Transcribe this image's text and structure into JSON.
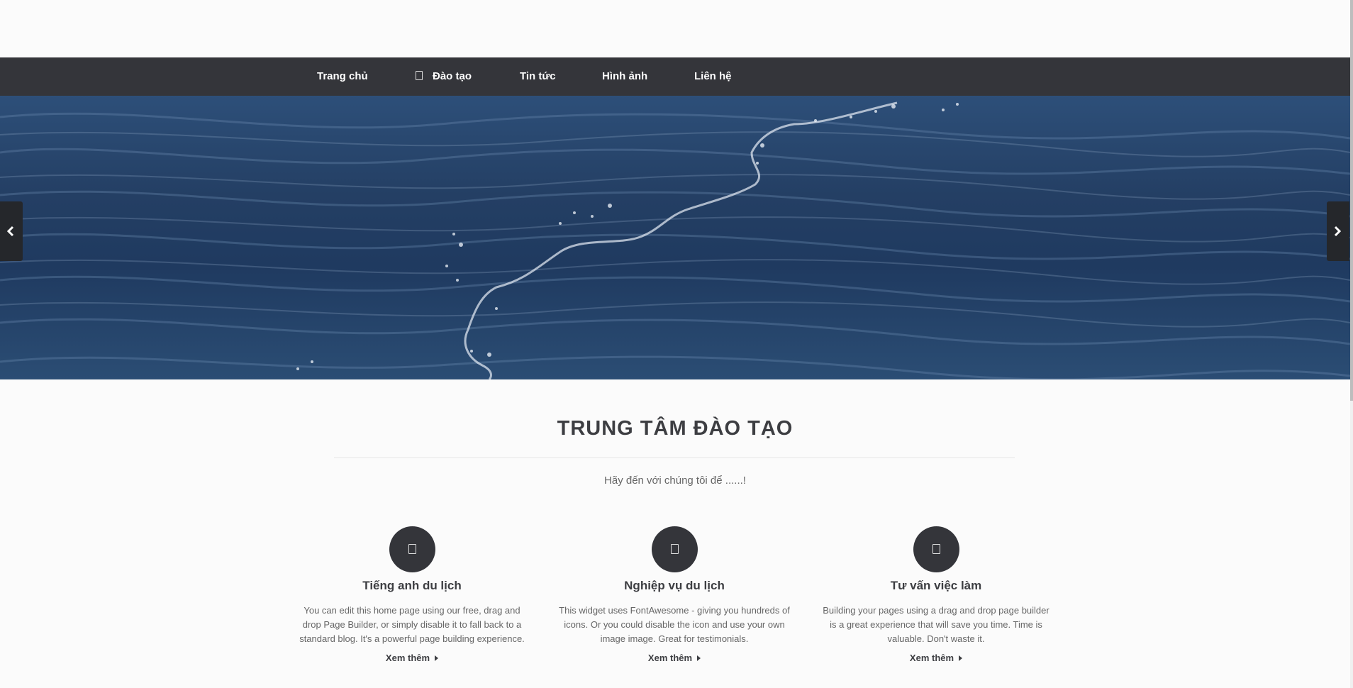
{
  "nav": {
    "items": [
      {
        "label": "Trang chủ",
        "icon": ""
      },
      {
        "label": "Đào tạo",
        "icon": "box-icon"
      },
      {
        "label": "Tin tức",
        "icon": ""
      },
      {
        "label": "Hình ảnh",
        "icon": ""
      },
      {
        "label": "Liên hệ",
        "icon": ""
      }
    ]
  },
  "hero": {
    "prev_icon": "chevron-left-icon",
    "next_icon": "chevron-right-icon"
  },
  "section": {
    "title": "TRUNG TÂM ĐÀO TẠO",
    "subtitle": "Hãy đến với chúng tôi để ......!"
  },
  "features": [
    {
      "icon": "box-icon",
      "title": "Tiếng anh du lịch",
      "text": "You can edit this home page using our free, drag and drop Page Builder, or simply disable it to fall back to a standard blog. It's a powerful page building experience.",
      "link": "Xem thêm"
    },
    {
      "icon": "box-icon",
      "title": "Nghiệp vụ du lịch",
      "text": "This widget uses FontAwesome - giving you hundreds of icons. Or you could disable the icon and use your own image image. Great for testimonials.",
      "link": "Xem thêm"
    },
    {
      "icon": "box-icon",
      "title": "Tư vấn việc làm",
      "text": "Building your pages using a drag and drop page builder is a great experience that will save you time. Time is valuable. Don't waste it.",
      "link": "Xem thêm"
    }
  ],
  "colors": {
    "navbar": "#34353a",
    "background": "#fbfbfb",
    "hero": "#243f64"
  }
}
